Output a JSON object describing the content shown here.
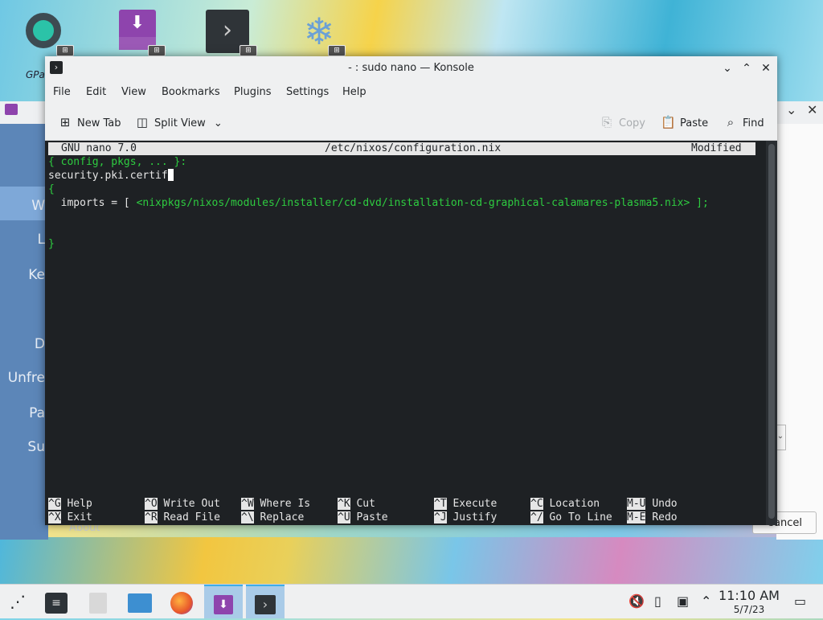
{
  "desktop": {
    "icons": [
      {
        "name": "gparted-icon",
        "label": "GPa"
      },
      {
        "name": "install-system-icon",
        "label": ""
      },
      {
        "name": "konsole-desktop-icon",
        "label": ""
      },
      {
        "name": "nixos-icon",
        "label": ""
      }
    ]
  },
  "background_window": {
    "sidebar_items": [
      "W",
      "L",
      "Ke",
      "D",
      "Unfre",
      "Pa",
      "Su"
    ],
    "about_label": "About",
    "cancel_label": "Cancel"
  },
  "konsole": {
    "title": "- : sudo nano — Konsole",
    "menu": [
      "File",
      "Edit",
      "View",
      "Bookmarks",
      "Plugins",
      "Settings",
      "Help"
    ],
    "toolbar": {
      "new_tab": "New Tab",
      "split_view": "Split View",
      "copy": "Copy",
      "paste": "Paste",
      "find": "Find"
    }
  },
  "nano": {
    "version": "GNU nano 7.0",
    "filename": "/etc/nixos/configuration.nix",
    "status": "Modified",
    "lines": {
      "l1": "{ config, pkgs, ... }:",
      "l2": "security.pki.certif",
      "l3": "{",
      "l4_prefix": "  imports = [ ",
      "l4_path": "<nixpkgs/nixos/modules/installer/cd-dvd/installation-cd-graphical-calamares-plasma5.nix>",
      "l4_suffix": " ];",
      "l7": "}"
    },
    "shortcuts": [
      {
        "key": "^G",
        "label": "Help"
      },
      {
        "key": "^X",
        "label": "Exit"
      },
      {
        "key": "^O",
        "label": "Write Out"
      },
      {
        "key": "^R",
        "label": "Read File"
      },
      {
        "key": "^W",
        "label": "Where Is"
      },
      {
        "key": "^\\",
        "label": "Replace"
      },
      {
        "key": "^K",
        "label": "Cut"
      },
      {
        "key": "^U",
        "label": "Paste"
      },
      {
        "key": "^T",
        "label": "Execute"
      },
      {
        "key": "^J",
        "label": "Justify"
      },
      {
        "key": "^C",
        "label": "Location"
      },
      {
        "key": "^/",
        "label": "Go To Line"
      },
      {
        "key": "M-U",
        "label": "Undo"
      },
      {
        "key": "M-E",
        "label": "Redo"
      }
    ]
  },
  "taskbar": {
    "clock_time": "11:10 AM",
    "clock_date": "5/7/23"
  }
}
